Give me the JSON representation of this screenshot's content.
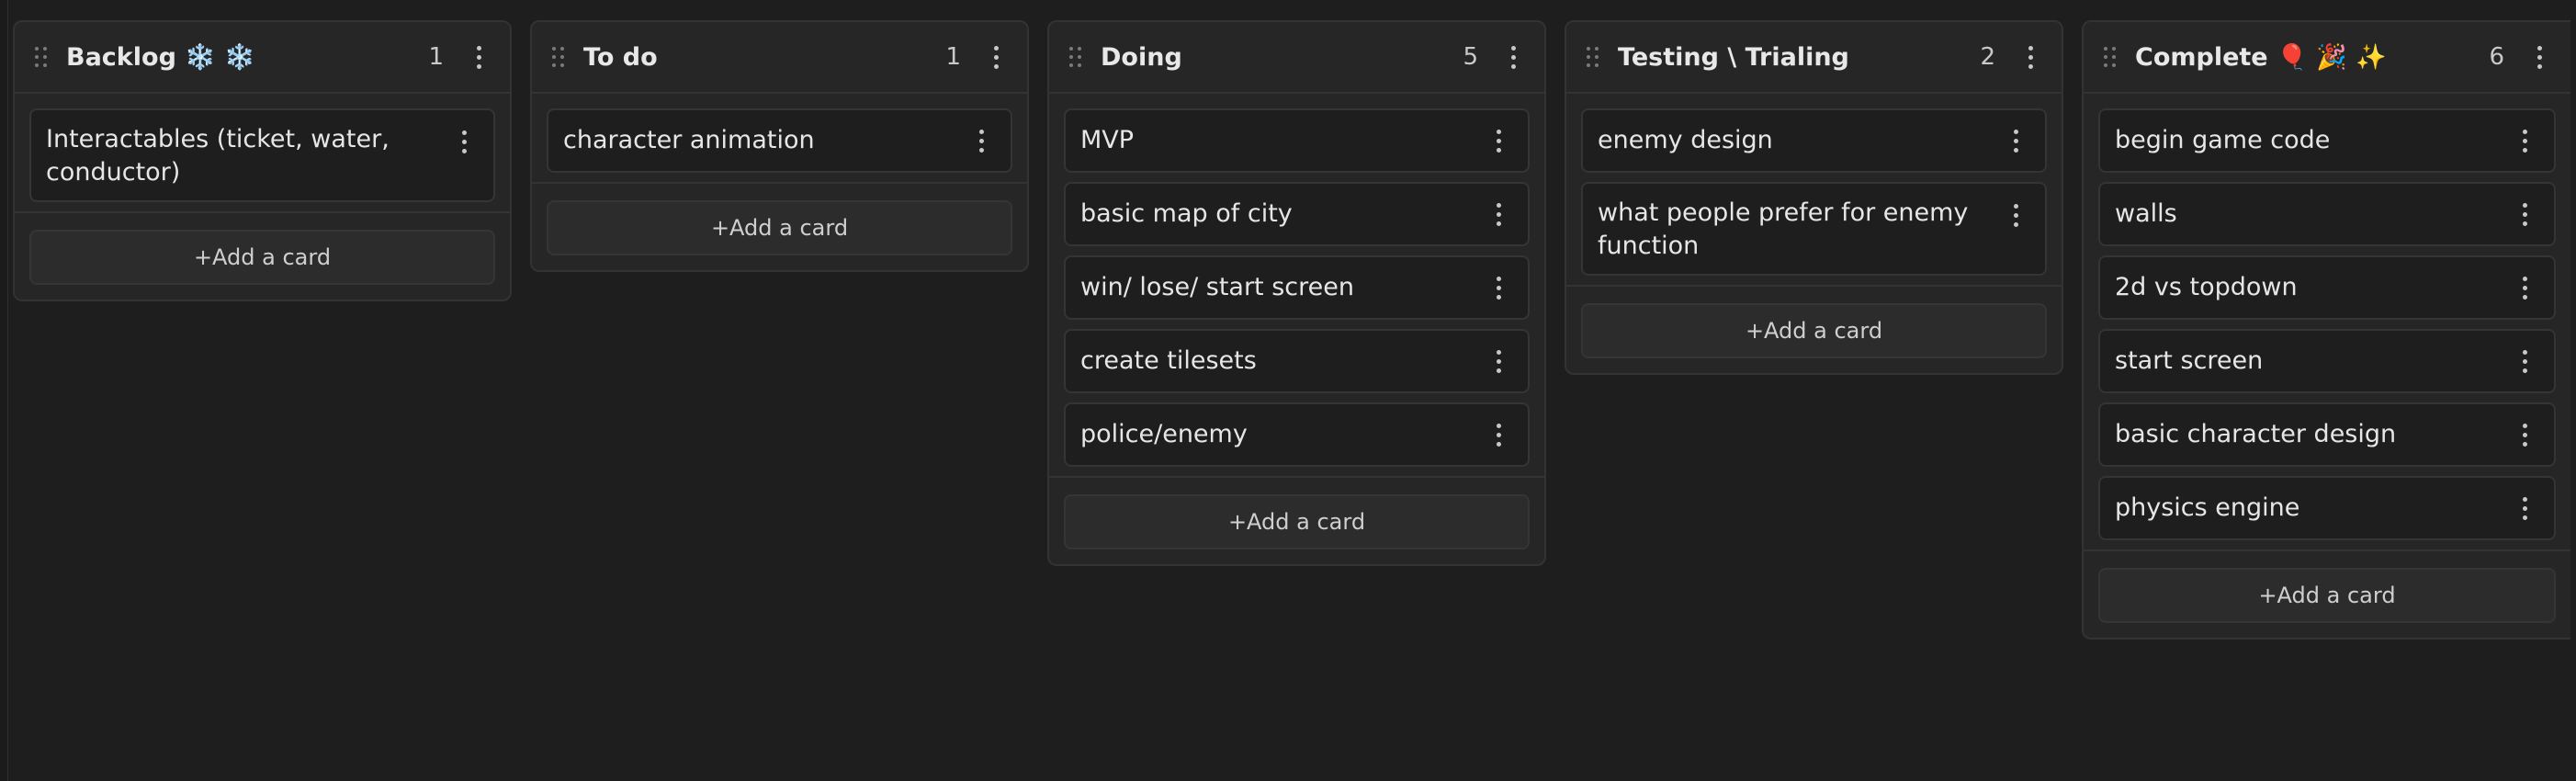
{
  "columns": [
    {
      "title": "Backlog ❄️ ❄️",
      "count": "1",
      "cards": [
        "Interactables (ticket, water, conductor)"
      ],
      "add_label": "+Add a card"
    },
    {
      "title": "To do",
      "count": "1",
      "cards": [
        "character animation"
      ],
      "add_label": "+Add a card"
    },
    {
      "title": "Doing",
      "count": "5",
      "cards": [
        "MVP",
        "basic map of city",
        "win/ lose/ start screen",
        "create tilesets",
        "police/enemy"
      ],
      "add_label": "+Add a card"
    },
    {
      "title": "Testing \\ Trialing",
      "count": "2",
      "cards": [
        "enemy design",
        "what people prefer for enemy function"
      ],
      "add_label": "+Add a card"
    },
    {
      "title": "Complete 🎈 🎉 ✨",
      "count": "6",
      "cards": [
        "begin game code",
        "walls",
        "2d vs topdown",
        "start screen",
        "basic character design",
        "physics engine"
      ],
      "add_label": "+Add a card"
    }
  ],
  "icons": {
    "drag": "drag-handle-icon",
    "more": "more-vertical-icon"
  }
}
